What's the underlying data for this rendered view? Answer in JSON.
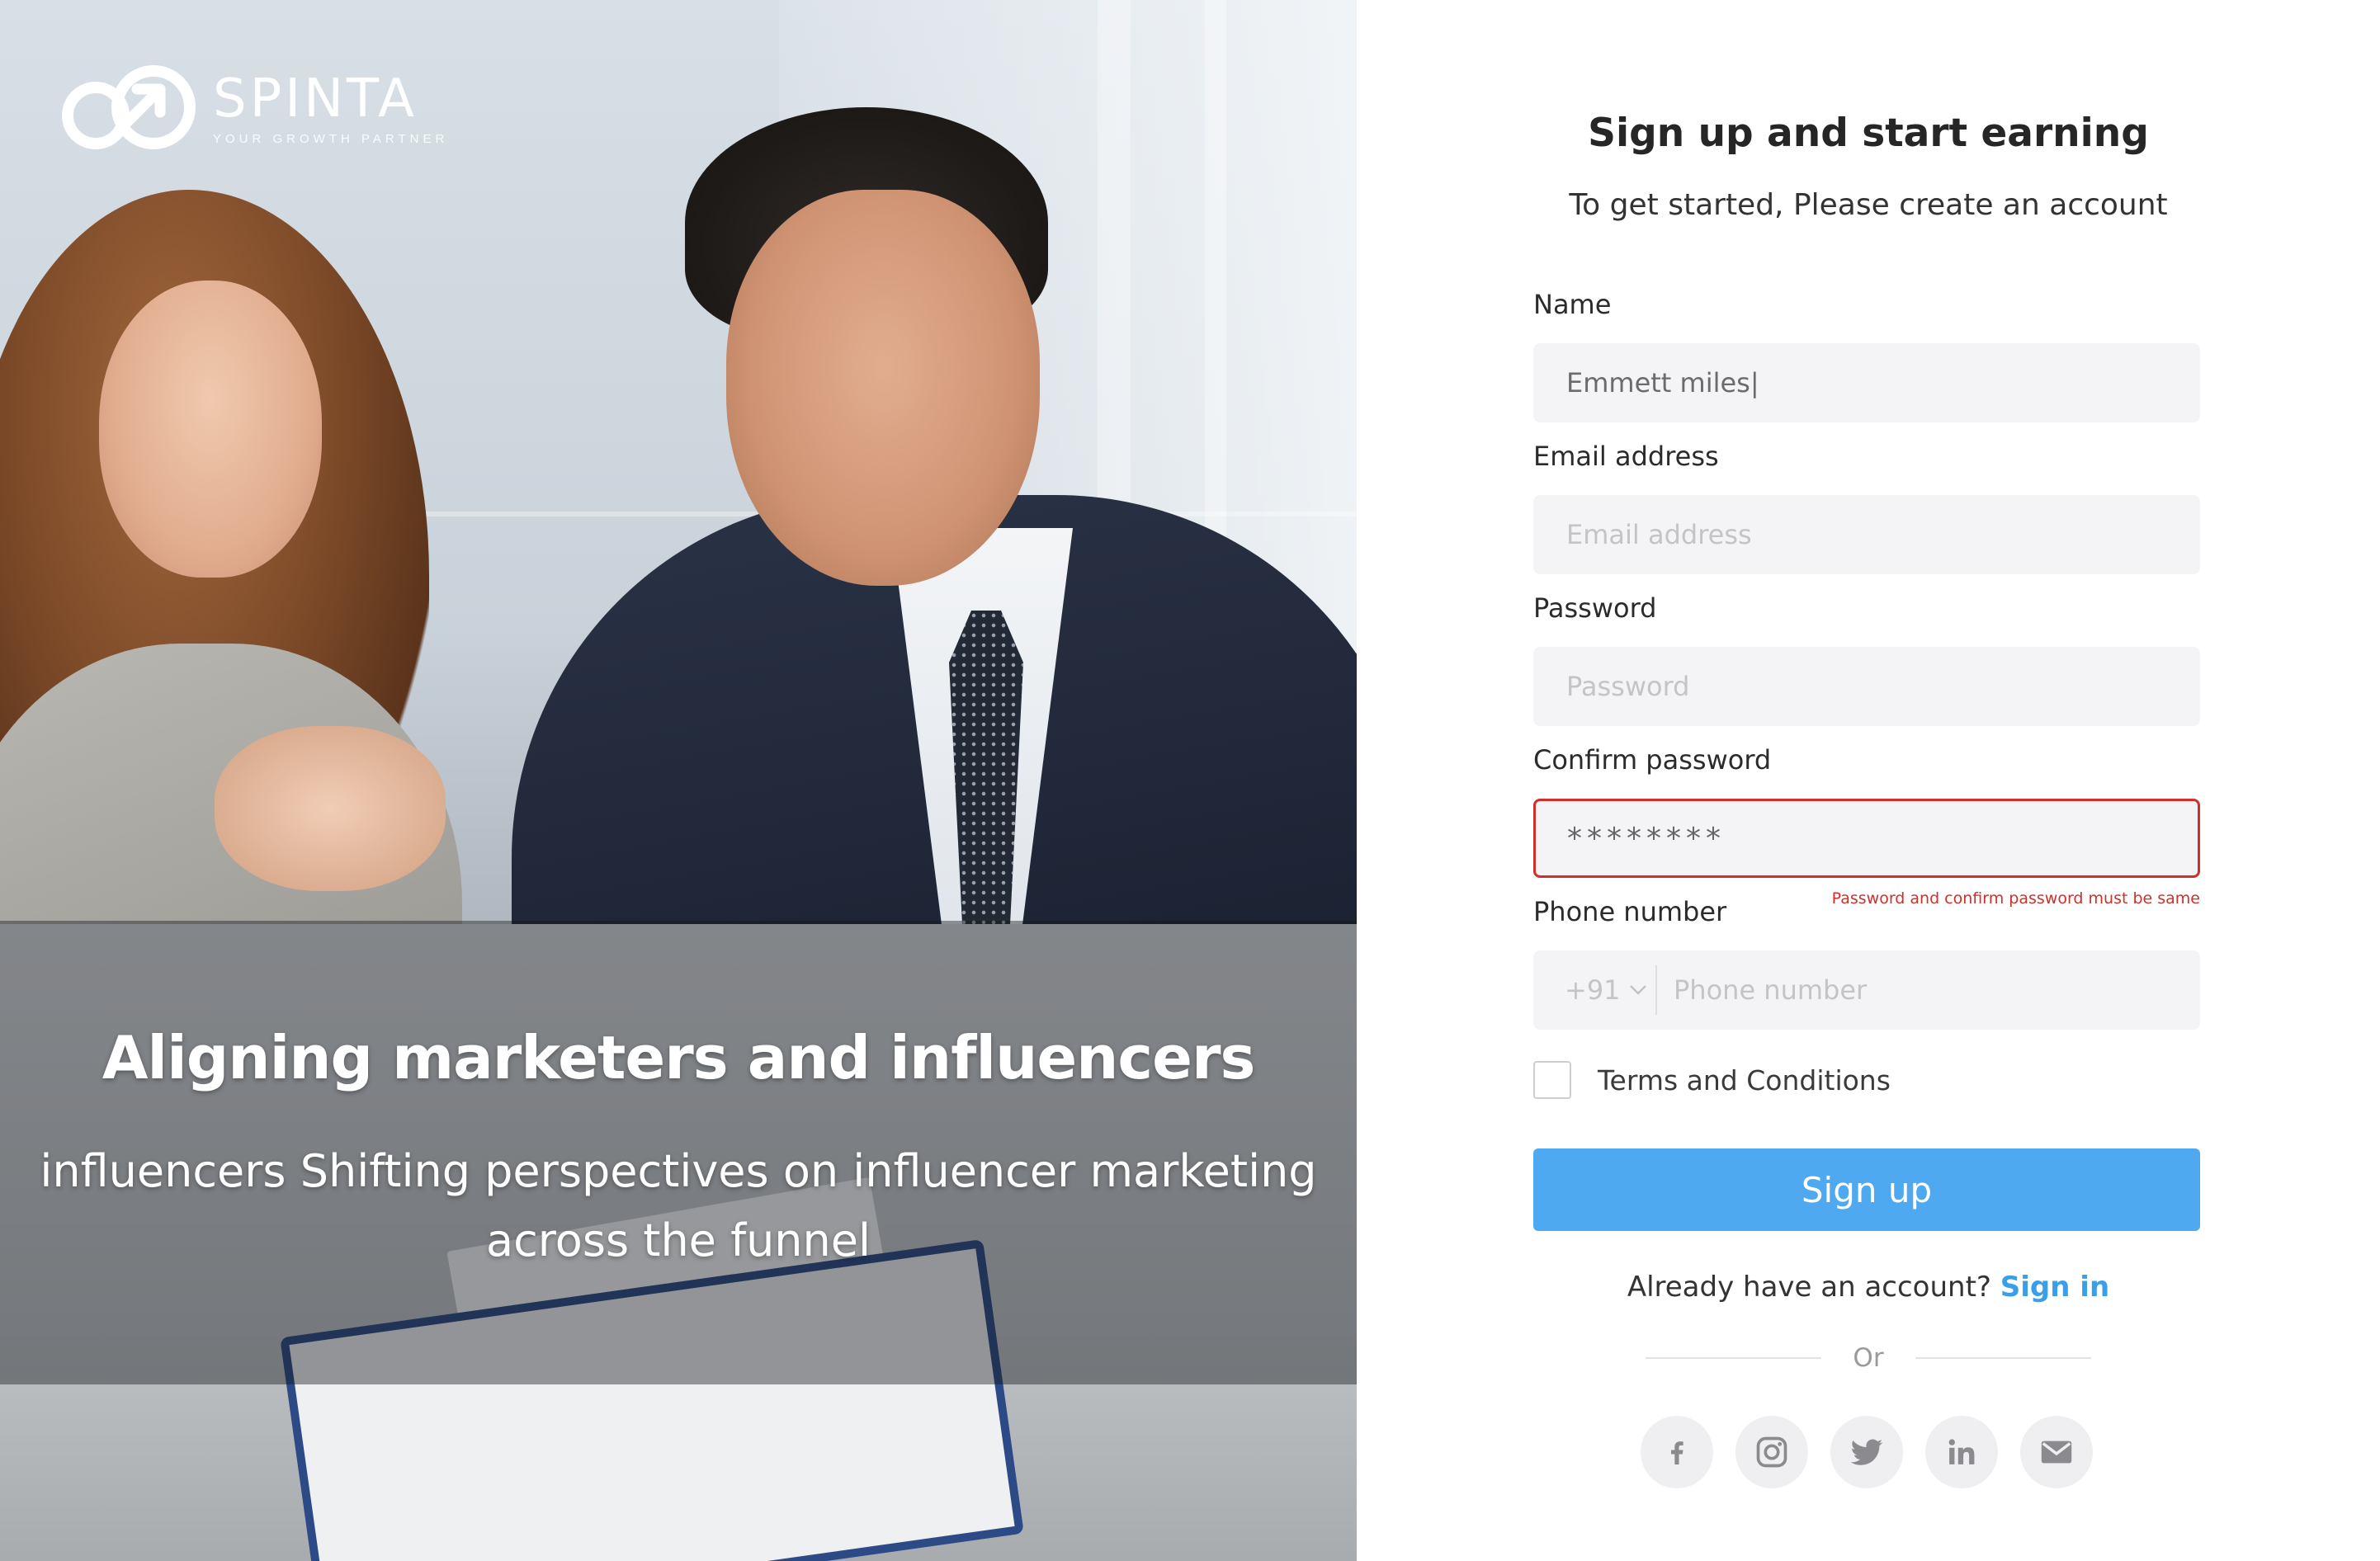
{
  "brand": {
    "name": "SPINTA",
    "tagline": "YOUR GROWTH PARTNER"
  },
  "hero": {
    "headline": "Aligning marketers and influencers",
    "subheadline": "influencers Shifting perspectives on influencer marketing across the funnel"
  },
  "form": {
    "title": "Sign up and start earning",
    "subtitle": "To get started, Please create an account",
    "name": {
      "label": "Name",
      "value": "Emmett miles|"
    },
    "email": {
      "label": "Email address",
      "placeholder": "Email address"
    },
    "password": {
      "label": "Password",
      "placeholder": "Password"
    },
    "confirm_password": {
      "label": "Confirm password",
      "value": "********",
      "error": "Password and confirm password must be same"
    },
    "phone": {
      "label": "Phone number",
      "country_code": "+91",
      "placeholder": "Phone number"
    },
    "terms_label": "Terms and Conditions",
    "submit_label": "Sign up",
    "signin_prompt": "Already have an account?",
    "signin_link": "Sign in",
    "or_label": "Or"
  },
  "social": [
    "facebook-icon",
    "instagram-icon",
    "twitter-icon",
    "linkedin-icon",
    "mail-icon"
  ],
  "colors": {
    "accent": "#4ea9f1",
    "link": "#3a9fe8",
    "error": "#d0302b",
    "input_bg": "#f4f4f6"
  }
}
